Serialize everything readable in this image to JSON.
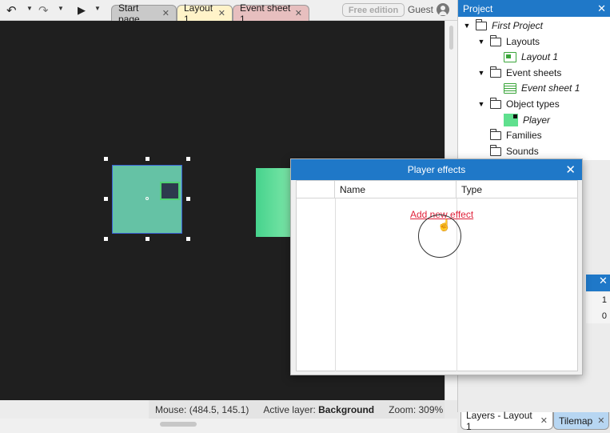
{
  "toolbar": {
    "undo_icon": "undo-icon",
    "redo_icon": "redo-icon",
    "play_icon": "play-icon",
    "tabs": [
      {
        "label": "Start page",
        "close": "✕"
      },
      {
        "label": "Layout 1",
        "close": "✕"
      },
      {
        "label": "Event sheet 1",
        "close": "✕"
      }
    ],
    "edition_badge": "Free edition",
    "user_label": "Guest"
  },
  "status": {
    "mouse_label": "Mouse:",
    "mouse_value": "(484.5, 145.1)",
    "layer_label": "Active layer:",
    "layer_value": "Background",
    "zoom_label": "Zoom:",
    "zoom_value": "309%"
  },
  "project": {
    "title": "Project",
    "close": "✕",
    "items": [
      {
        "label": "First Project"
      },
      {
        "label": "Layouts"
      },
      {
        "label": "Layout 1"
      },
      {
        "label": "Event sheets"
      },
      {
        "label": "Event sheet 1"
      },
      {
        "label": "Object types"
      },
      {
        "label": "Player"
      },
      {
        "label": "Families"
      },
      {
        "label": "Sounds"
      }
    ]
  },
  "layers": {
    "close": "✕",
    "values": [
      "1",
      "0"
    ]
  },
  "bottom_tabs": [
    {
      "label": "Layers - Layout 1",
      "close": "✕"
    },
    {
      "label": "Tilemap",
      "close": "✕"
    }
  ],
  "dialog": {
    "title": "Player effects",
    "close": "✕",
    "columns": [
      "",
      "Name",
      "Type"
    ],
    "add_link": "Add new effect"
  },
  "colors": {
    "accent": "#1f78c8",
    "player": "#5fe08e",
    "link": "#e0213a"
  }
}
